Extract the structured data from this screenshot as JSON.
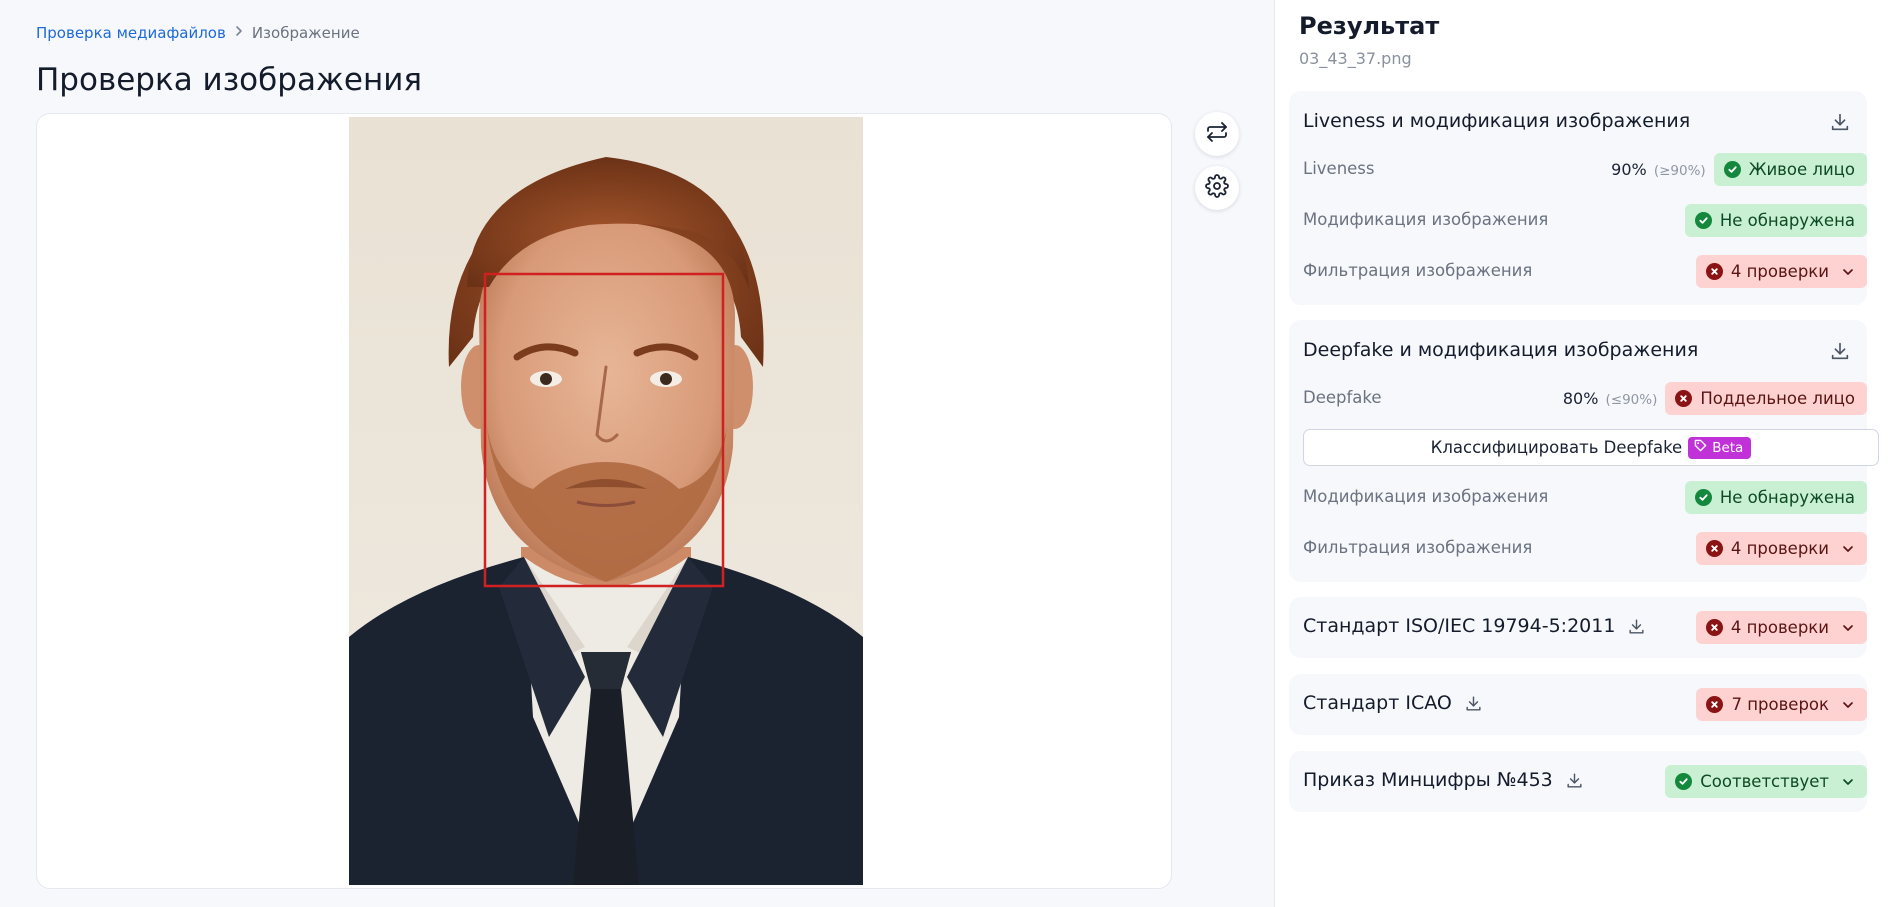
{
  "breadcrumb": {
    "root": "Проверка медиафайлов",
    "current": "Изображение"
  },
  "page": {
    "title": "Проверка изображения"
  },
  "viewer": {
    "swap_icon": "swap-icon",
    "settings_icon": "gear-icon"
  },
  "result": {
    "title": "Результат",
    "filename": "03_43_37.png",
    "liveness_card": {
      "title": "Liveness и модификация изображения",
      "liveness": {
        "label": "Liveness",
        "score": "90%",
        "threshold": "(≥90%)",
        "verdict": "Живое лицо"
      },
      "modification": {
        "label": "Модификация изображения",
        "verdict": "Не обнаружена"
      },
      "filtration": {
        "label": "Фильтрация изображения",
        "verdict": "4 проверки"
      }
    },
    "deepfake_card": {
      "title": "Deepfake и модификация изображения",
      "deepfake": {
        "label": "Deepfake",
        "score": "80%",
        "threshold": "(≤90%)",
        "verdict": "Поддельное лицо"
      },
      "classify": {
        "label": "Классифицировать Deepfake",
        "badge": "Beta"
      },
      "modification": {
        "label": "Модификация изображения",
        "verdict": "Не обнаружена"
      },
      "filtration": {
        "label": "Фильтрация изображения",
        "verdict": "4 проверки"
      }
    },
    "iso_card": {
      "title": "Стандарт ISO/IEC 19794-5:2011",
      "verdict": "4 проверки"
    },
    "icao_card": {
      "title": "Стандарт ICAO",
      "verdict": "7 проверок"
    },
    "mincifry_card": {
      "title": "Приказ Минцифры №453",
      "verdict": "Соответствует"
    }
  },
  "colors": {
    "link": "#1d6ad8",
    "ok_bg": "#c9f0d2",
    "ok_icon": "#14883d",
    "bad_bg": "#ffd2d2",
    "bad_icon": "#8a1414",
    "face_box": "#d02020",
    "beta": "#c032d8"
  }
}
